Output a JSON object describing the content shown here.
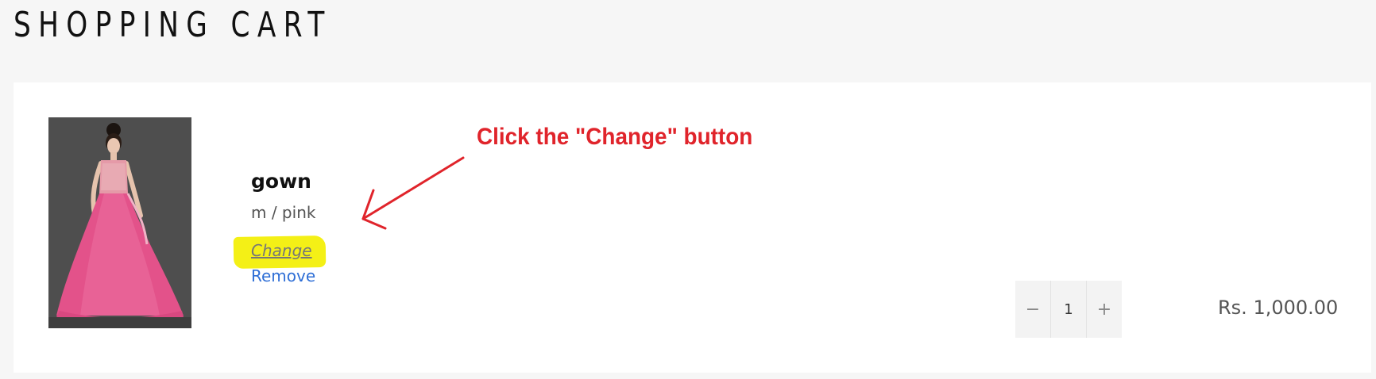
{
  "page": {
    "title": "SHOPPING CART"
  },
  "cart": {
    "item": {
      "image_icon": "product-photo-pink-gown",
      "name": "gown",
      "variant": "m / pink",
      "change_label": "Change",
      "remove_label": "Remove",
      "quantity": "1",
      "decrement_label": "−",
      "increment_label": "+",
      "price": "Rs. 1,000.00"
    }
  },
  "annotation": {
    "text": "Click the \"Change\" button",
    "arrow_icon": "red-arrow-icon",
    "color": "#e0242b",
    "highlight_color": "#f4f016"
  },
  "colors": {
    "background": "#f6f6f6",
    "panel": "#ffffff",
    "link": "#2f6fd6"
  }
}
